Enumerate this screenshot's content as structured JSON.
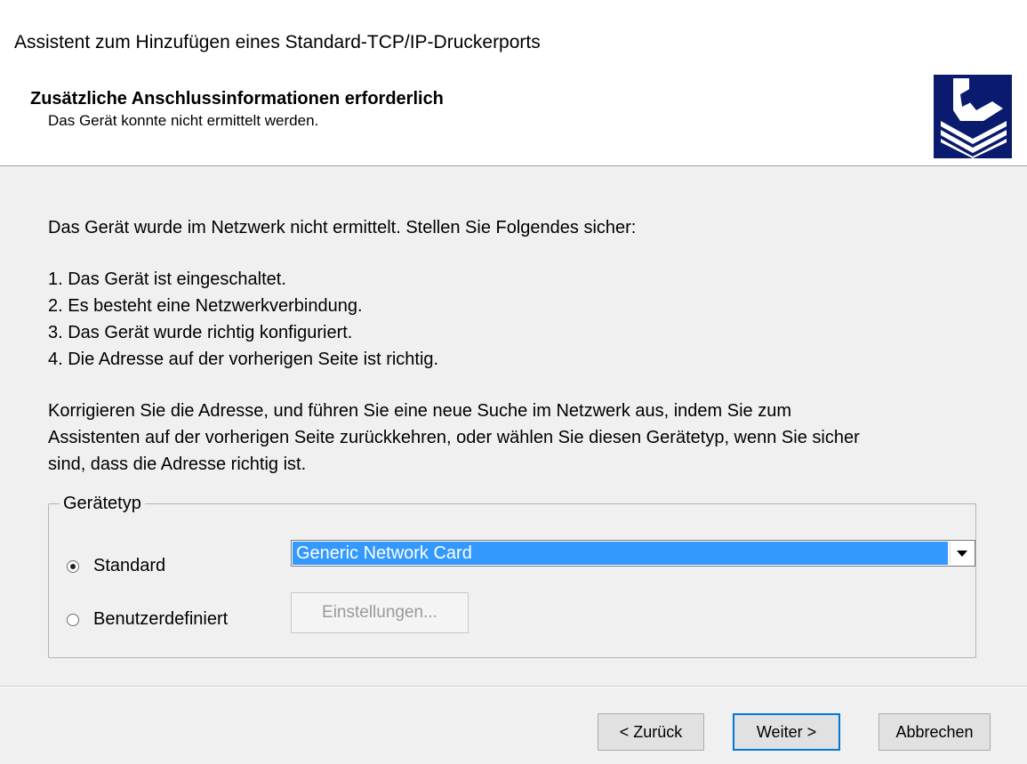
{
  "window": {
    "title": "Assistent zum Hinzufügen eines Standard-TCP/IP-Druckerports"
  },
  "header": {
    "title": "Zusätzliche Anschlussinformationen erforderlich",
    "subtitle": "Das Gerät konnte nicht ermittelt werden.",
    "icon": "printer-port-icon"
  },
  "content": {
    "intro": "Das Gerät wurde im Netzwerk nicht ermittelt. Stellen Sie Folgendes sicher:",
    "checklist": [
      "1. Das Gerät ist eingeschaltet.",
      "2. Es besteht eine Netzwerkverbindung.",
      "3. Das Gerät wurde richtig konfiguriert.",
      "4. Die Adresse auf der vorherigen Seite ist richtig."
    ],
    "correction_lines": [
      "Korrigieren Sie die Adresse, und führen Sie eine neue Suche im Netzwerk aus, indem Sie zum",
      "Assistenten auf der vorherigen Seite zurückkehren, oder wählen Sie diesen Gerätetyp, wenn Sie sicher",
      "sind, dass die Adresse richtig ist."
    ]
  },
  "device_type": {
    "legend": "Gerätetyp",
    "options": [
      {
        "label": "Standard",
        "selected": true
      },
      {
        "label": "Benutzerdefiniert",
        "selected": false
      }
    ],
    "standard_selected_value": "Generic Network Card",
    "settings_button": {
      "label": "Einstellungen...",
      "enabled": false
    }
  },
  "footer": {
    "back_label": "< Zurück",
    "next_label": "Weiter >",
    "cancel_label": "Abbrechen"
  },
  "colors": {
    "selection": "#3399ff",
    "focus_border": "#0078d7",
    "icon_navy": "#0a1a6e"
  }
}
